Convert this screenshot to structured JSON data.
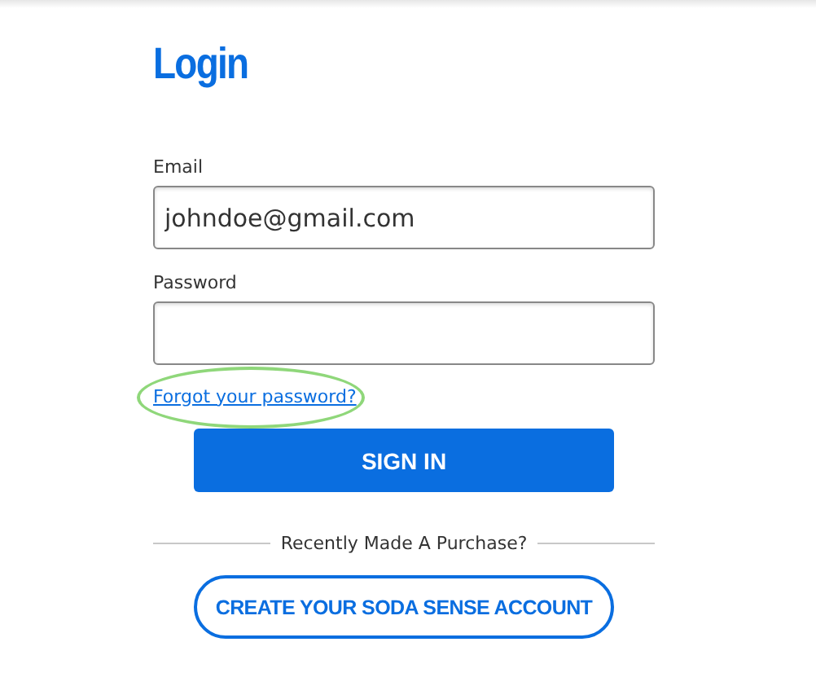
{
  "title": "Login",
  "fields": [
    {
      "label": "Email",
      "value": "johndoe@gmail.com",
      "kind": "text"
    },
    {
      "label": "Password",
      "kind": "password"
    }
  ],
  "forgot_link": {
    "text": "Forgot your password?",
    "highlighted": true
  },
  "sign_in_button": "SIGN IN",
  "divider_text": "Recently Made A Purchase?",
  "create_account_button": "CREATE YOUR SODA SENSE ACCOUNT"
}
